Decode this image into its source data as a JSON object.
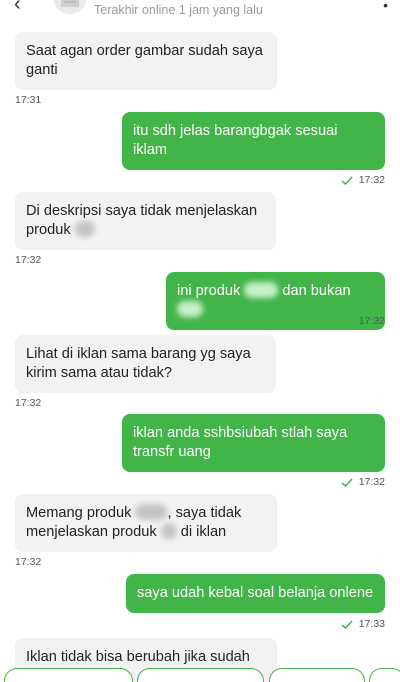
{
  "header": {
    "status": "Terakhir online 1 jam yang lalu",
    "back_icon": "back-arrow-icon",
    "more_icon": "more-vertical-icon"
  },
  "colors": {
    "accent": "#42b549",
    "incoming_bubble": "#f2f2f2"
  },
  "messages": [
    {
      "dir": "in",
      "line1": "Saat agan order gambar sudah saya",
      "line2": "ganti",
      "time": "17:31"
    },
    {
      "dir": "out",
      "line1": "itu sdh jelas barangbgak sesuai",
      "line2": "iklam",
      "time": "17:32"
    },
    {
      "dir": "in",
      "line1": "Di deskripsi saya tidak menjelaskan",
      "line2": "produk",
      "time": "17:32"
    },
    {
      "dir": "out",
      "pre": "ini produk",
      "mid": "dan bukan",
      "time": "17:32"
    },
    {
      "dir": "in",
      "line1": "Lihat di iklan sama barang yg saya",
      "line2": "kirim sama atau tidak?",
      "time": "17:32"
    },
    {
      "dir": "out",
      "line1": "iklan anda sshbsiubah stlah saya",
      "line2": "transfr uang",
      "time": "17:32"
    },
    {
      "dir": "in",
      "pre": "Memang produk",
      "post": ", saya tidak",
      "line2a": "menjelaskan produk",
      "line2b": "di iklan",
      "time": "17:32"
    },
    {
      "dir": "out",
      "line1": "saya udah kebal soal belanja onlene",
      "time": "17:33"
    },
    {
      "dir": "in",
      "line1": "Iklan tidak bisa berubah jika sudah"
    }
  ]
}
